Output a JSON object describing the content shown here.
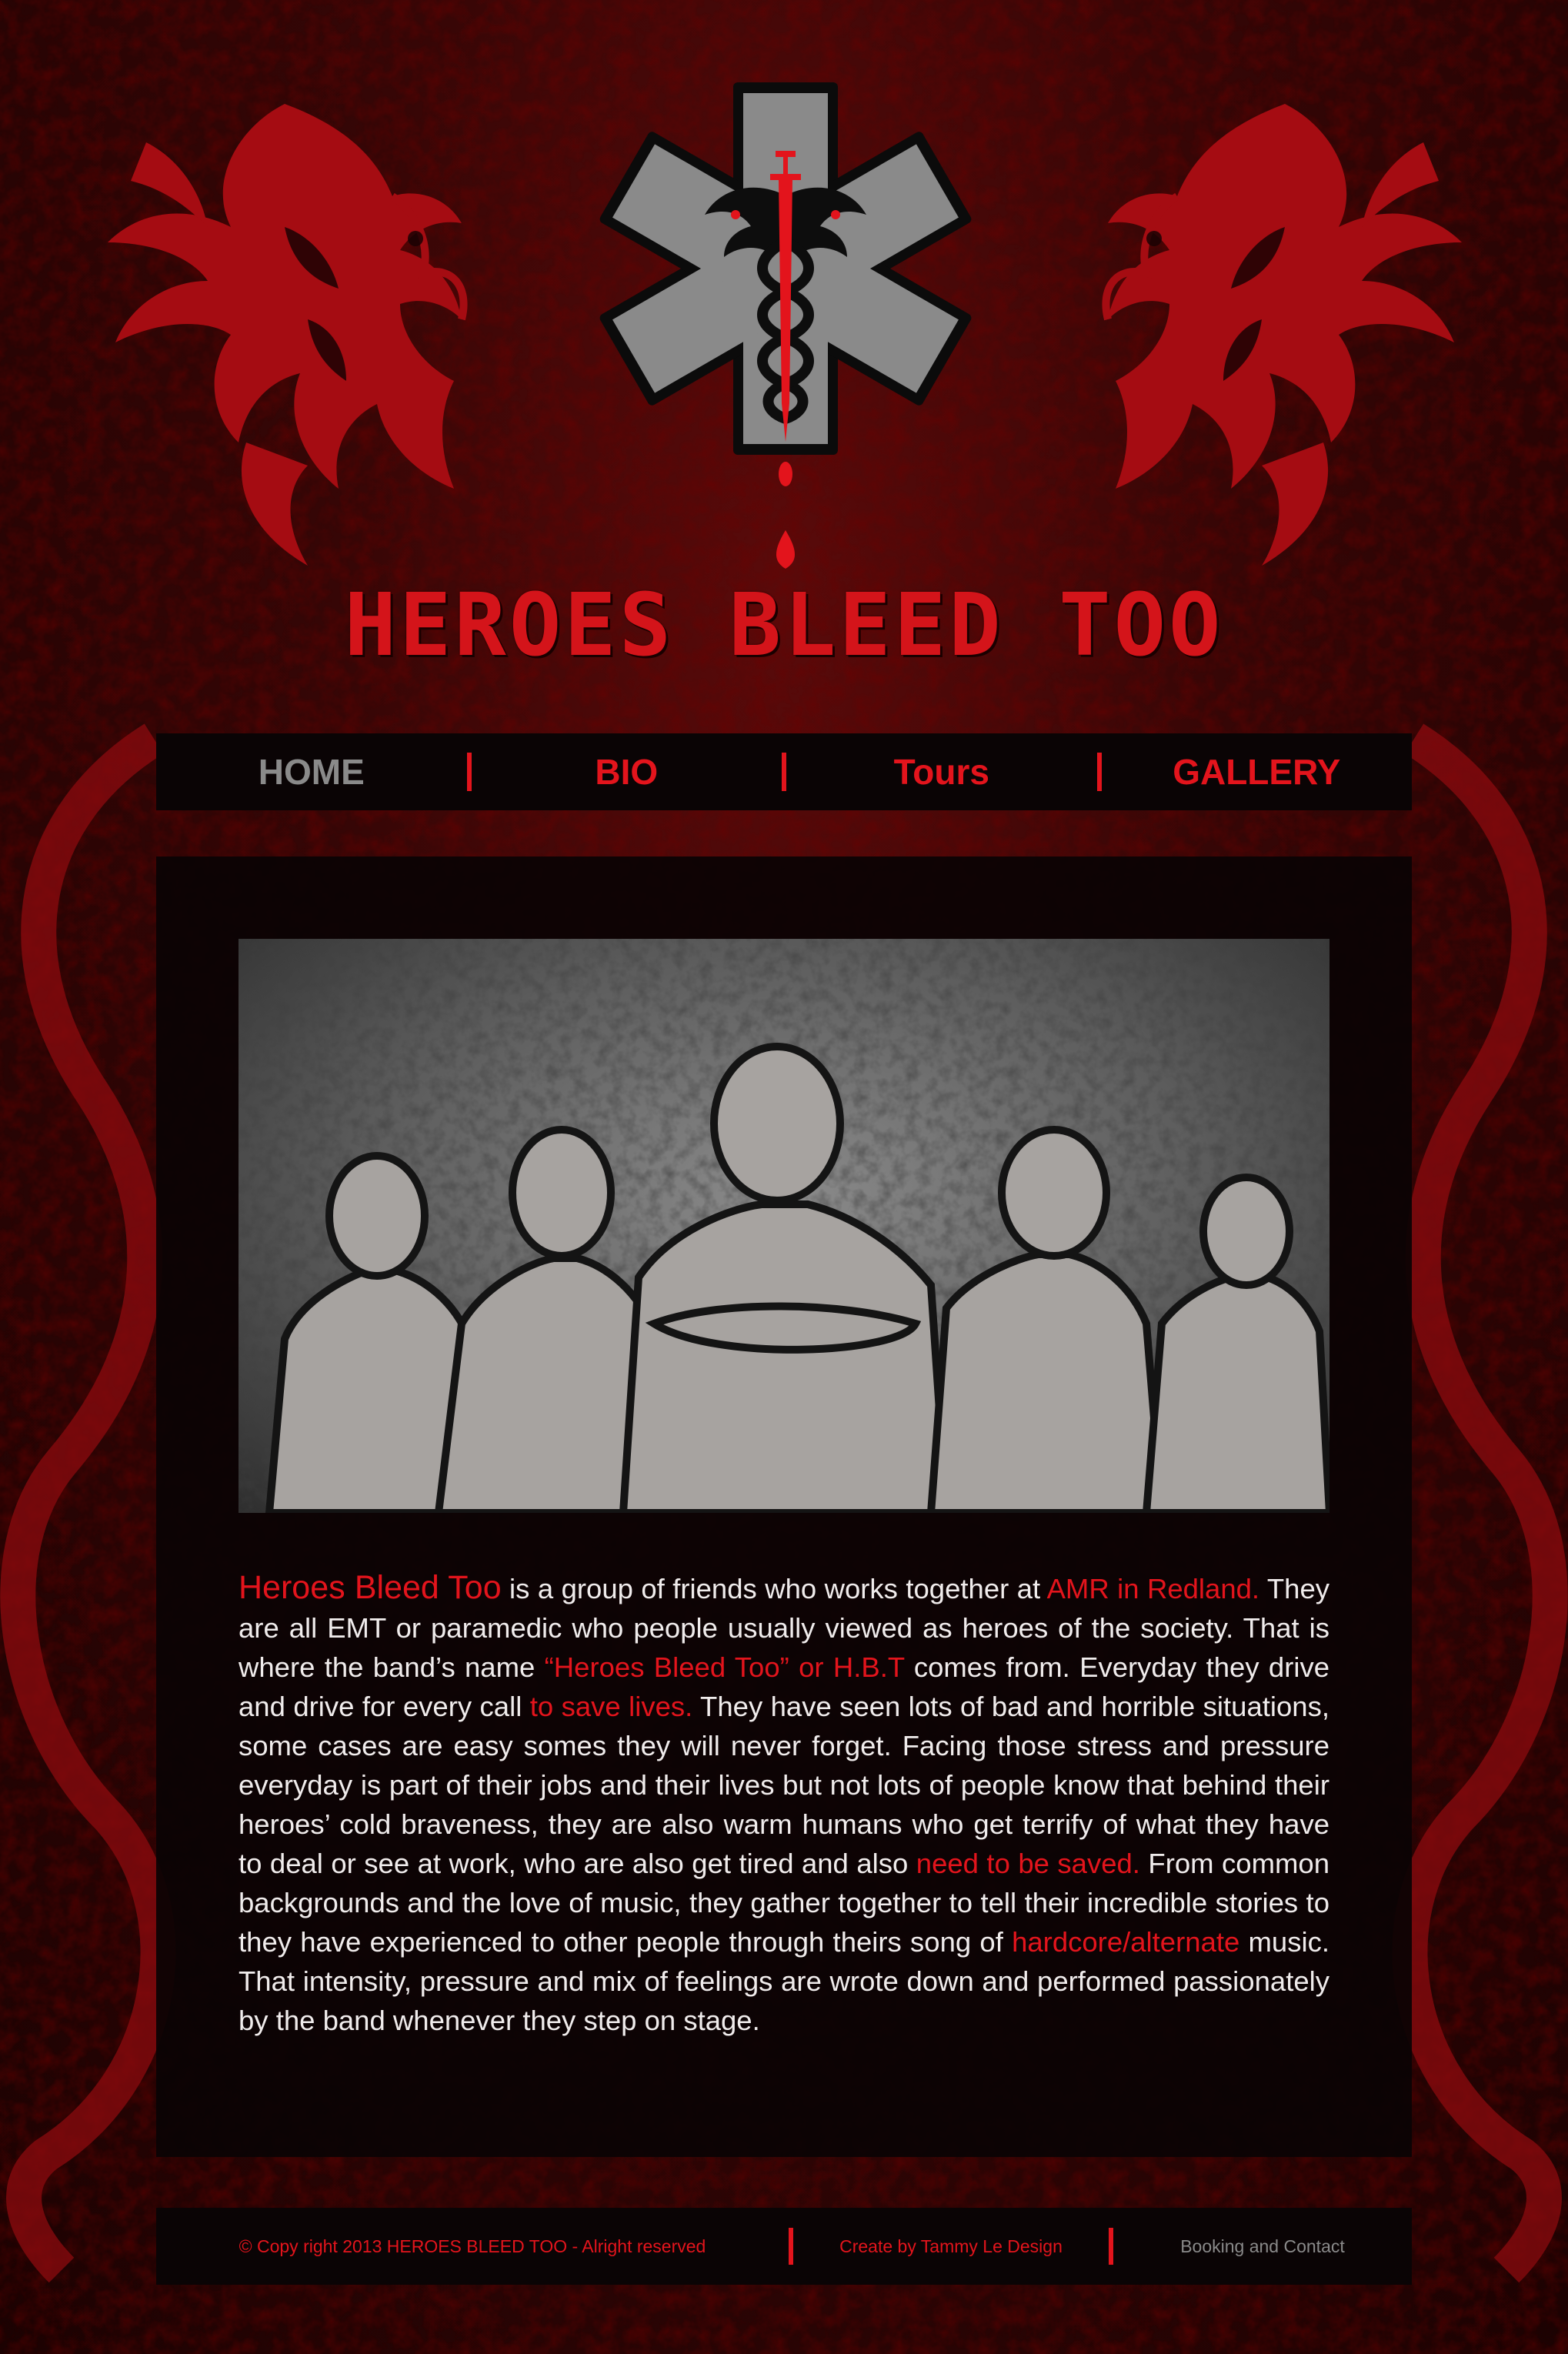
{
  "site": {
    "title": "HEROES BLEED TOO"
  },
  "nav": {
    "items": [
      {
        "label": "HOME",
        "active": true
      },
      {
        "label": "BIO"
      },
      {
        "label": "Tours"
      },
      {
        "label": "GALLERY"
      }
    ]
  },
  "bio": {
    "band_name": "Heroes Bleed Too",
    "t1": " is a group of friends who works together at ",
    "h1": "AMR in Redland.",
    "t2": " They are all EMT or paramedic who people usually viewed as heroes of the society. That  is where the band’s name ",
    "h2": "“Heroes Bleed Too” or H.B.T",
    "t3": " comes from. Everyday they drive and drive for every call ",
    "h3": "to save lives.",
    "t4": " They have seen lots of bad and horrible situations, some cases are easy somes they will never forget. Facing those stress and pressure everyday is part of their jobs and their lives but not lots of people know that behind their heroes’ cold braveness, they are also warm humans who get terrify of what they have to deal or see at work, who are also get tired and also ",
    "h4": "need to be saved.",
    "t5": " From common backgrounds and the love of music, they gather together to tell their incredible stories to they have experienced to other people through theirs song of ",
    "h5": "hardcore/alternate",
    "t6": " music. That intensity, pressure and mix of feelings are wrote down and performed passionately by the band whenever they step on stage."
  },
  "footer": {
    "copyright": "© Copy right 2013 HEROES BLEED TOO - Alright reserved",
    "credit": "Create by Tammy Le Design",
    "contact": "Booking and Contact"
  },
  "colors": {
    "accent": "#e3141c",
    "nav_active": "#8a8a8a",
    "panel": "#0a0405",
    "background": "#360606"
  },
  "icons": {
    "logo": "star-of-life-icon",
    "emblem": "twin-dragon-caduceus-icon",
    "decor": "dragon-icon"
  }
}
